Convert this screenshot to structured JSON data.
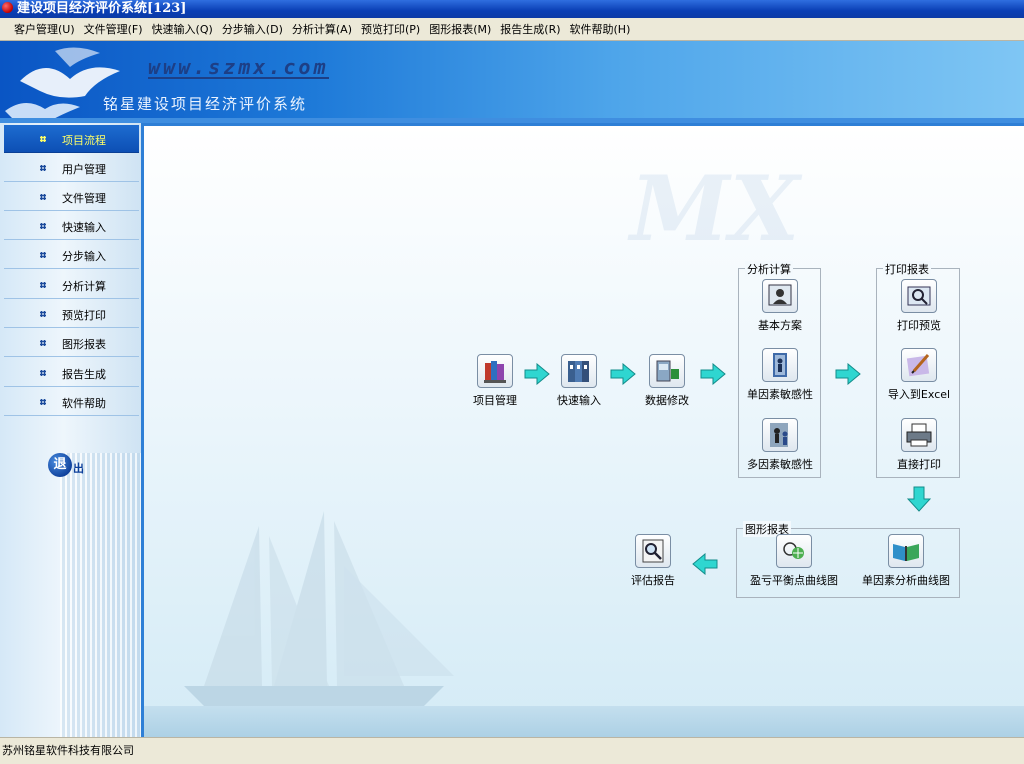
{
  "window": {
    "title": "建设项目经济评价系统[123]"
  },
  "menu": [
    "客户管理(U)",
    "文件管理(F)",
    "快速输入(Q)",
    "分步输入(D)",
    "分析计算(A)",
    "预览打印(P)",
    "图形报表(M)",
    "报告生成(R)",
    "软件帮助(H)"
  ],
  "banner": {
    "url": "www.szmx.com",
    "product": "铭星建设项目经济评价系统"
  },
  "sidebar": {
    "items": [
      "项目流程",
      "用户管理",
      "文件管理",
      "快速输入",
      "分步输入",
      "分析计算",
      "预览打印",
      "图形报表",
      "报告生成",
      "软件帮助"
    ],
    "active_index": 0,
    "exit_first": "退",
    "exit_rest": "出"
  },
  "watermark": "MX",
  "flow": {
    "project_manage": "项目管理",
    "quick_input": "快速输入",
    "data_modify": "数据修改",
    "analysis": {
      "title": "分析计算",
      "basic_plan": "基本方案",
      "single_factor": "单因素敏感性",
      "multi_factor": "多因素敏感性"
    },
    "print": {
      "title": "打印报表",
      "preview": "打印预览",
      "export_excel": "导入到Excel",
      "direct_print": "直接打印"
    },
    "charts": {
      "title": "图形报表",
      "breakeven": "盈亏平衡点曲线图",
      "single_factor_curve": "单因素分析曲线图"
    },
    "evaluation_report": "评估报告"
  },
  "status": {
    "company": "苏州铭星软件科技有限公司"
  }
}
